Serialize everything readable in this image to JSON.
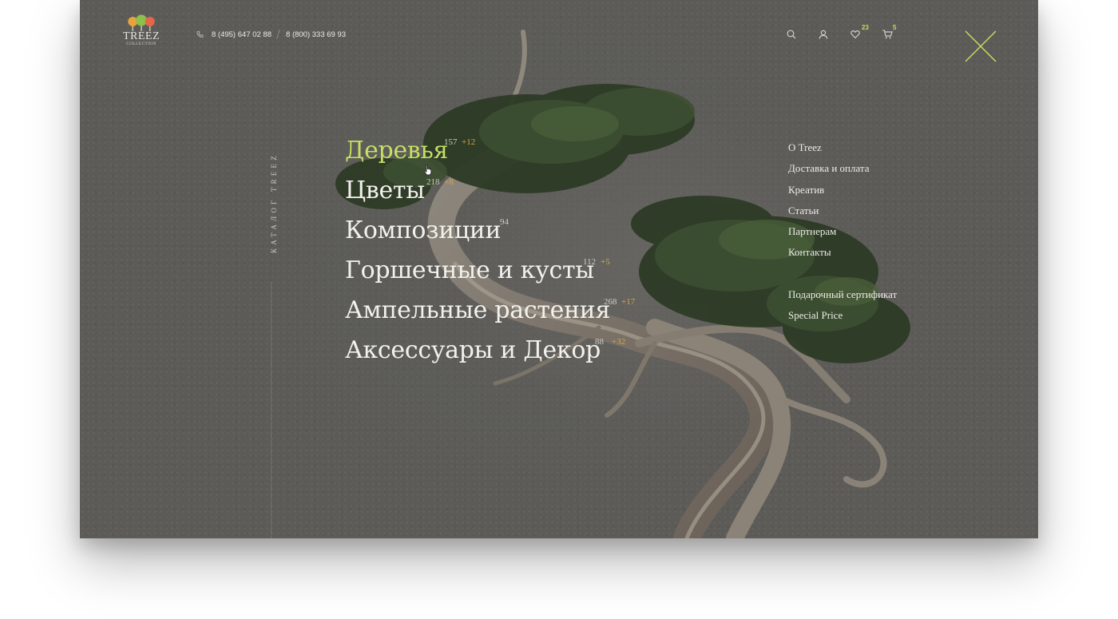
{
  "brand": {
    "name": "TREEZ",
    "tagline": "COLLECTION"
  },
  "header": {
    "phones": [
      "8 (495) 647 02 88",
      "8 (800) 333 69 93"
    ],
    "icons": {
      "search": "search-icon",
      "account": "user-icon",
      "favorites": "heart-icon",
      "cart": "cart-icon",
      "close": "close-icon"
    },
    "favorites_count": "23",
    "cart_count": "5"
  },
  "catalog_label": "КАТАЛОГ TREEZ",
  "main_menu": [
    {
      "label": "Деревья",
      "count": "157",
      "new": "+12",
      "active": true
    },
    {
      "label": "Цветы",
      "count": "218",
      "new": "+8"
    },
    {
      "label": "Композиции",
      "count": "94",
      "new": ""
    },
    {
      "label": "Горшечные и кусты",
      "count": "112",
      "new": "+5"
    },
    {
      "label": "Ампельные растения",
      "count": "268",
      "new": "+17"
    },
    {
      "label": "Аксессуары и Декор",
      "count": "88",
      "new": "+32"
    }
  ],
  "side_menu": {
    "primary": [
      "О Treez",
      "Доставка и оплата",
      "Креатив",
      "Статьи",
      "Партнерам",
      "Контакты"
    ],
    "secondary": [
      "Подарочный сертификат",
      "Special Price"
    ]
  },
  "colors": {
    "accent": "#c6df63",
    "new_badge": "#d6a844",
    "background": "#5c5b58",
    "text": "#f2f1ec"
  }
}
